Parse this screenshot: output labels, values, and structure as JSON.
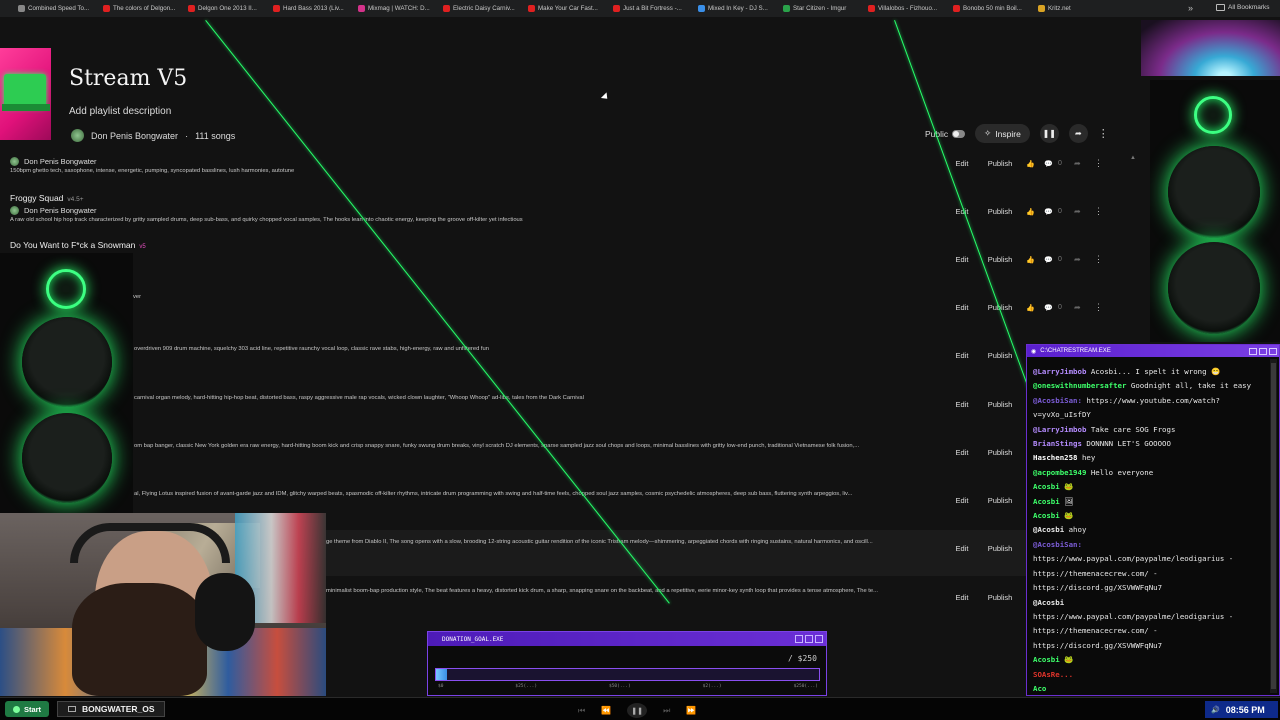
{
  "bookmarks": [
    {
      "label": "Combined Speed To...",
      "color": "#888888"
    },
    {
      "label": "The colors of Delgon...",
      "color": "#e02020"
    },
    {
      "label": "Delgon One 2013 II...",
      "color": "#e02020"
    },
    {
      "label": "Hard Bass 2013 (Liv...",
      "color": "#e02020"
    },
    {
      "label": "Mixmag | WATCH: D...",
      "color": "#d4328a"
    },
    {
      "label": "Electric Daisy Carniv...",
      "color": "#e02020"
    },
    {
      "label": "Make Your Car Fast...",
      "color": "#e02020"
    },
    {
      "label": "Just a Bit Fortress -...",
      "color": "#e02020"
    },
    {
      "label": "Mixed In Key - DJ S...",
      "color": "#3a8fe8"
    },
    {
      "label": "Star Citizen - Imgur",
      "color": "#2aa24a"
    },
    {
      "label": "Villalobos - Fizhouo...",
      "color": "#e02020"
    },
    {
      "label": "Bonobo 50 min Boil...",
      "color": "#e02020"
    },
    {
      "label": "Kritz.net",
      "color": "#d9a324"
    }
  ],
  "bookmarks_more": "»",
  "all_bookmarks": "All Bookmarks",
  "playlist": {
    "title": "Stream V5",
    "description": "Add playlist description",
    "owner": "Don Penis Bongwater",
    "song_count": "111 songs",
    "visibility_label": "Public",
    "inspire_label": "Inspire",
    "inspire_icon": "✧",
    "pause_icon": "❚❚",
    "share_icon": "➦",
    "more_icon": "⋮"
  },
  "row_actions": {
    "edit": "Edit",
    "publish": "Publish",
    "like_icon": "👍",
    "comment_icon": "💬",
    "count": "0",
    "share_icon": "➦",
    "more_icon": "⋮"
  },
  "songs": [
    {
      "title": "",
      "version": "",
      "artist": "Don Penis Bongwater",
      "description": "150bpm ghetto tech, saxophone, intense, energetic, pumping, syncopated basslines, lush harmonies, autotune"
    },
    {
      "title": "Froggy Squad",
      "version": "v4.5+",
      "artist": "Don Penis Bongwater",
      "description": "A raw old school hip hop track characterized by gritty sampled drums, deep sub-bass, and quirky chopped vocal samples, The hooks lean into chaotic energy, keeping the groove off-kilter yet infectious"
    },
    {
      "title": "Do You Want to F*ck a Snowman",
      "version": "v5",
      "artist": "",
      "description": ""
    },
    {
      "title": "",
      "version": "",
      "artist": "",
      "description": "ver"
    },
    {
      "title": "",
      "version": "",
      "artist": "",
      "description": "overdriven 909 drum machine, squelchy 303 acid line, repetitive raunchy vocal loop, classic rave stabs, high-energy, raw and unfiltered fun"
    },
    {
      "title": "",
      "version": "",
      "artist": "",
      "description": "carnival organ melody, hard-hitting hip-hop beat, distorted bass, raspy aggressive male rap vocals, wicked clown laughter, \"Whoop Whoop\" ad-libs, tales from the Dark Carnival"
    },
    {
      "title": "",
      "version": "",
      "artist": "",
      "description": "om bap banger, classic New York golden era raw energy, hard-hitting boom kick and crisp snappy snare, funky swung drum breaks, vinyl scratch DJ elements, sparse sampled jazz soul chops and loops, minimal basslines with gritty low-end punch, traditional Vietnamese folk fusion,..."
    },
    {
      "title": "",
      "version": "",
      "artist": "",
      "description": "al, Flying Lotus inspired fusion of avant-garde jazz and IDM, glitchy warped beats, spasmodic off-kilter rhythms, intricate drum programming with swing and half-time feels, chopped soul jazz samples, cosmic psychedelic atmospheres, deep sub bass, fluttering synth arpeggios, liv..."
    },
    {
      "title": "",
      "version": "",
      "artist": "",
      "description": "ge theme from Diablo II, The song opens with a slow, brooding 12-string acoustic guitar rendition of the iconic Tristram melody—shimmering, arpeggiated chords with ringing sustains, natural harmonics, and oscill..."
    },
    {
      "title": "",
      "version": "",
      "artist": "",
      "description": "minimalist boom-bap production style, The beat features a heavy, distorted kick drum, a sharp, snapping snare on the backbeat, and a repetitive, eerie minor-key synth loop that provides a tense atmosphere, The te..."
    }
  ],
  "chat": {
    "window_title": "C:\\CHATRESTREAM.EXE",
    "lines": [
      {
        "user": "@LarryJimbob",
        "text": "Acosbi... I spelt it wrong 😁",
        "color": "#b58cff"
      },
      {
        "user": "@oneswithnumbersafter",
        "text": "Goodnight all, take it easy",
        "color": "#3dff6a"
      },
      {
        "user": "@AcosbiSan:",
        "text": "https://www.youtube.com/watch?",
        "color": "#7b5cd6"
      },
      {
        "user": "",
        "text": "v=yvXo_uIsfDY",
        "color": "#e8e8e8"
      },
      {
        "user": "@LarryJimbob",
        "text": "Take care SOG Frogs",
        "color": "#b58cff"
      },
      {
        "user": "BrianStings",
        "text": "DONNNN LET'S GOOOOO",
        "color": "#b58cff"
      },
      {
        "user": "Haschen258",
        "text": "hey",
        "color": "#ffffff"
      },
      {
        "user": "@acpombe1949",
        "text": "Hello everyone",
        "color": "#3dff6a"
      },
      {
        "user": "Acosbi",
        "text": "🐸",
        "color": "#3dff6a"
      },
      {
        "user": "Acosbi",
        "text": "🖼",
        "color": "#3dff6a"
      },
      {
        "user": "Acosbi",
        "text": "🐸",
        "color": "#3dff6a"
      },
      {
        "user": "@Acosbi",
        "text": "ahoy",
        "color": "#e8e8e8"
      },
      {
        "user": "@AcosbiSan:",
        "text": "",
        "color": "#7b5cd6"
      },
      {
        "user": "",
        "text": "https://www.paypal.com/paypalme/leodigarius -",
        "color": "#e8e8e8"
      },
      {
        "user": "",
        "text": "https://themenacecrew.com/ -",
        "color": "#e8e8e8"
      },
      {
        "user": "",
        "text": "https://discord.gg/XSVWWFqNu7",
        "color": "#e8e8e8"
      },
      {
        "user": "@Acosbi",
        "text": "",
        "color": "#e8e8e8"
      },
      {
        "user": "",
        "text": "https://www.paypal.com/paypalme/leodigarius -",
        "color": "#e8e8e8"
      },
      {
        "user": "",
        "text": "https://themenacecrew.com/ -",
        "color": "#e8e8e8"
      },
      {
        "user": "",
        "text": "https://discord.gg/XSVWWFqNu7",
        "color": "#e8e8e8"
      },
      {
        "user": "Acosbi",
        "text": "🐸",
        "color": "#3dff6a"
      },
      {
        "user": "SOAsRe...",
        "text": "",
        "color": "#e0342b"
      },
      {
        "user": "Aco",
        "text": "",
        "color": "#3dff6a"
      }
    ]
  },
  "donation": {
    "window_title": "DONATION_GOAL.EXE",
    "goal": "/ $250",
    "progress_fraction": 0.03,
    "ticks": [
      "$0",
      "$25(...)",
      "$50(...)",
      "$2(...)",
      "$250(...)"
    ]
  },
  "taskbar": {
    "start_label": "Start",
    "app_label": "BONGWATER_OS",
    "clock": "08:56 PM",
    "prev_icon": "⏮",
    "rewind_icon": "⏪",
    "play_icon": "❚❚",
    "next_icon": "⏭",
    "skip_icon": "⏩",
    "volume_icon": "🔊"
  },
  "colors": {
    "accent_green": "#26ff6a",
    "window_purple": "#6a2fd0",
    "background": "#121212"
  }
}
